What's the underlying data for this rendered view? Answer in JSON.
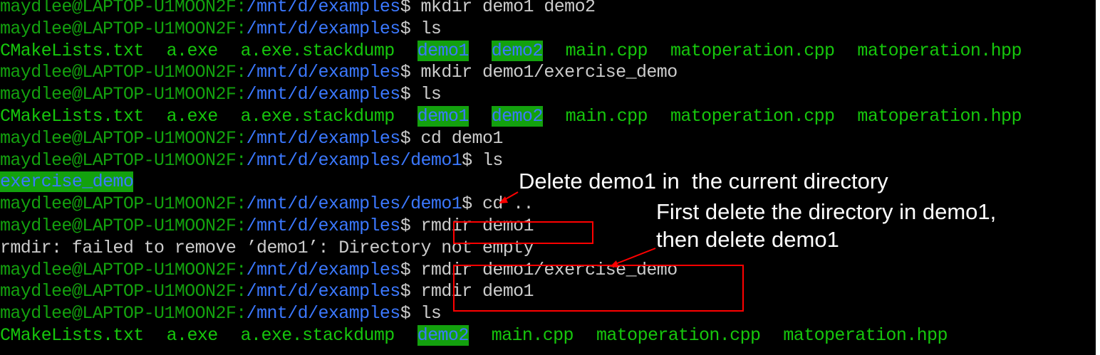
{
  "prompt": {
    "user": "maydlee@LAPTOP-U1MOON2F",
    "sep": ":",
    "dollar": "$ "
  },
  "lines": [
    {
      "kind": "cmd",
      "path": "/mnt/d/examples",
      "command": "mkdir demo1 demo2"
    },
    {
      "kind": "cmd",
      "path": "/mnt/d/examples",
      "command": "ls"
    },
    {
      "kind": "ls",
      "entries": [
        {
          "name": "CMakeLists.txt",
          "type": "file"
        },
        {
          "name": "a.exe",
          "type": "file"
        },
        {
          "name": "a.exe.stackdump",
          "type": "file"
        },
        {
          "name": "demo1",
          "type": "dir"
        },
        {
          "name": "demo2",
          "type": "dir"
        },
        {
          "name": "main.cpp",
          "type": "file"
        },
        {
          "name": "matoperation.cpp",
          "type": "file"
        },
        {
          "name": "matoperation.hpp",
          "type": "file"
        }
      ]
    },
    {
      "kind": "cmd",
      "path": "/mnt/d/examples",
      "command": "mkdir demo1/exercise_demo"
    },
    {
      "kind": "cmd",
      "path": "/mnt/d/examples",
      "command": "ls"
    },
    {
      "kind": "ls",
      "entries": [
        {
          "name": "CMakeLists.txt",
          "type": "file"
        },
        {
          "name": "a.exe",
          "type": "file"
        },
        {
          "name": "a.exe.stackdump",
          "type": "file"
        },
        {
          "name": "demo1",
          "type": "dir"
        },
        {
          "name": "demo2",
          "type": "dir"
        },
        {
          "name": "main.cpp",
          "type": "file"
        },
        {
          "name": "matoperation.cpp",
          "type": "file"
        },
        {
          "name": "matoperation.hpp",
          "type": "file"
        }
      ]
    },
    {
      "kind": "cmd",
      "path": "/mnt/d/examples",
      "command": "cd demo1"
    },
    {
      "kind": "cmd",
      "path": "/mnt/d/examples/demo1",
      "command": "ls"
    },
    {
      "kind": "ls",
      "entries": [
        {
          "name": "exercise_demo",
          "type": "dir"
        }
      ]
    },
    {
      "kind": "cmd",
      "path": "/mnt/d/examples/demo1",
      "command": "cd .."
    },
    {
      "kind": "cmd",
      "path": "/mnt/d/examples",
      "command": "rmdir demo1"
    },
    {
      "kind": "text",
      "text": "rmdir: failed to remove ’demo1’: Directory not empty"
    },
    {
      "kind": "cmd",
      "path": "/mnt/d/examples",
      "command": "rmdir demo1/exercise_demo"
    },
    {
      "kind": "cmd",
      "path": "/mnt/d/examples",
      "command": "rmdir demo1"
    },
    {
      "kind": "cmd",
      "path": "/mnt/d/examples",
      "command": "ls"
    },
    {
      "kind": "ls",
      "entries": [
        {
          "name": "CMakeLists.txt",
          "type": "file"
        },
        {
          "name": "a.exe",
          "type": "file"
        },
        {
          "name": "a.exe.stackdump",
          "type": "file"
        },
        {
          "name": "demo2",
          "type": "dir"
        },
        {
          "name": "main.cpp",
          "type": "file"
        },
        {
          "name": "matoperation.cpp",
          "type": "file"
        },
        {
          "name": "matoperation.hpp",
          "type": "file"
        }
      ]
    }
  ],
  "annotations": {
    "note1": "Delete demo1 in  the current directory",
    "note2_line1": "First delete the directory in demo1,",
    "note2_line2": "then delete demo1"
  },
  "colors": {
    "background": "#000000",
    "prompt_user": "#13a10e",
    "prompt_path": "#3b78ff",
    "directory_highlight": "#13a10e",
    "annotation_box": "#ff0000",
    "annotation_text": "#ffffff"
  }
}
